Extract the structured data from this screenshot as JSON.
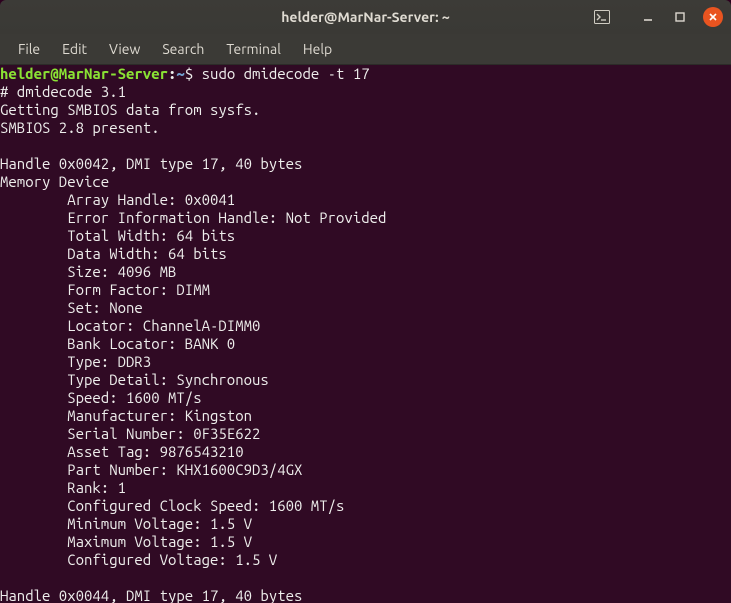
{
  "window": {
    "title": "helder@MarNar-Server: ~"
  },
  "menubar": {
    "items": [
      "File",
      "Edit",
      "View",
      "Search",
      "Terminal",
      "Help"
    ]
  },
  "prompt": {
    "userhost": "helder@MarNar-Server",
    "colon": ":",
    "path": "~",
    "symbol": "$ "
  },
  "command": "sudo dmidecode -t 17",
  "output_lines": [
    "# dmidecode 3.1",
    "Getting SMBIOS data from sysfs.",
    "SMBIOS 2.8 present.",
    "",
    "Handle 0x0042, DMI type 17, 40 bytes",
    "Memory Device",
    "        Array Handle: 0x0041",
    "        Error Information Handle: Not Provided",
    "        Total Width: 64 bits",
    "        Data Width: 64 bits",
    "        Size: 4096 MB",
    "        Form Factor: DIMM",
    "        Set: None",
    "        Locator: ChannelA-DIMM0",
    "        Bank Locator: BANK 0",
    "        Type: DDR3",
    "        Type Detail: Synchronous",
    "        Speed: 1600 MT/s",
    "        Manufacturer: Kingston",
    "        Serial Number: 0F35E622",
    "        Asset Tag: 9876543210",
    "        Part Number: KHX1600C9D3/4GX",
    "        Rank: 1",
    "        Configured Clock Speed: 1600 MT/s",
    "        Minimum Voltage: 1.5 V",
    "        Maximum Voltage: 1.5 V",
    "        Configured Voltage: 1.5 V",
    "",
    "Handle 0x0044, DMI type 17, 40 bytes"
  ]
}
